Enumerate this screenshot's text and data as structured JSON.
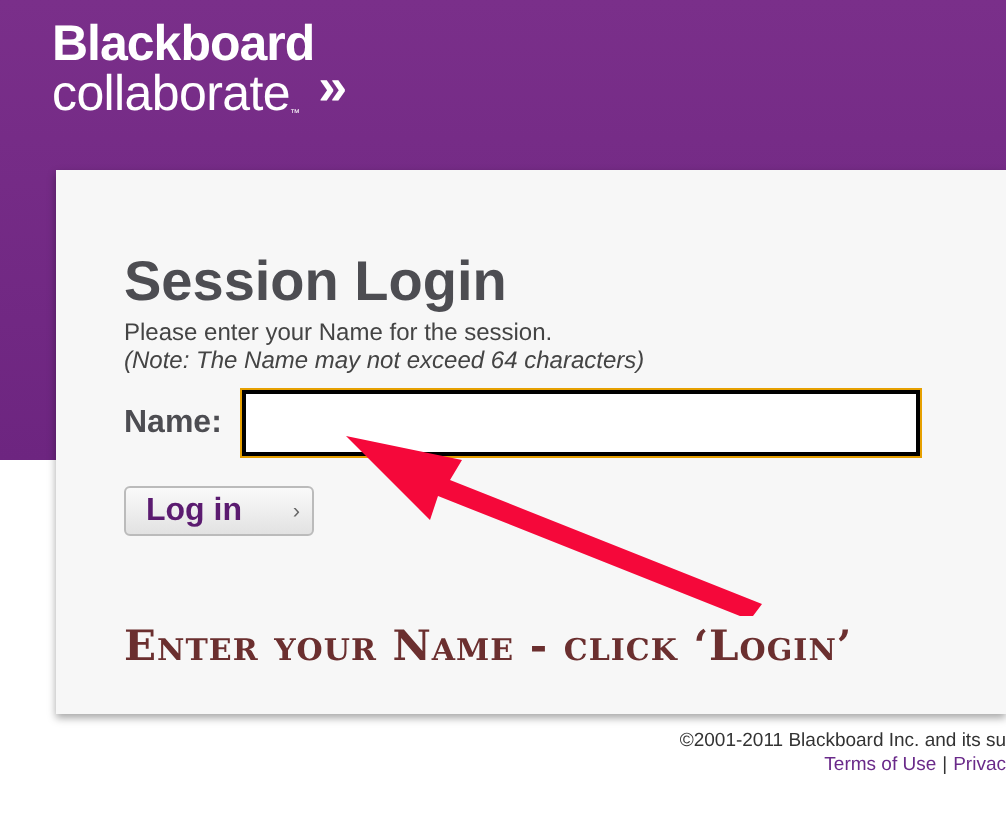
{
  "header": {
    "brand_line1": "Blackboard",
    "brand_line2": "collaborate",
    "brand_mark": "»",
    "trademark": "™"
  },
  "login": {
    "title": "Session Login",
    "instruction": "Please enter your Name for the session.",
    "note": "(Note: The Name may not exceed 64 characters)",
    "name_label": "Name:",
    "name_field": {
      "focused": true
    },
    "button": {
      "label": "Log in",
      "chevron": "›"
    }
  },
  "annotation": "Enter your Name - click ‘Login’",
  "footer": {
    "copyright": "©2001-2011 Blackboard Inc. and its su",
    "links": [
      "Terms of Use",
      "Privac"
    ],
    "separator": "|"
  }
}
